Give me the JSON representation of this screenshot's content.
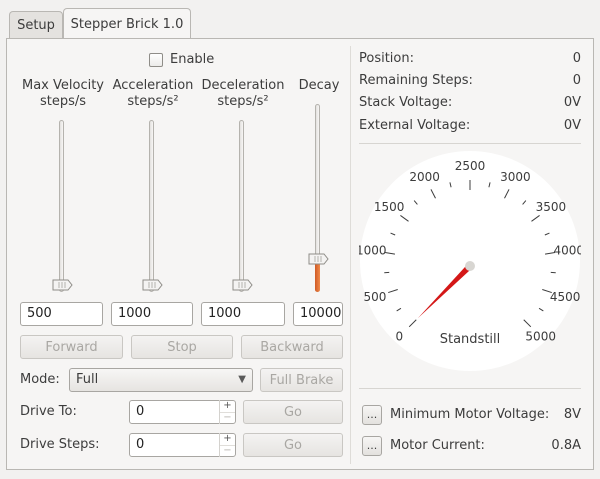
{
  "tabs": [
    {
      "label": "Setup",
      "active": false
    },
    {
      "label": "Stepper Brick 1.0",
      "active": true
    }
  ],
  "enable": {
    "label": "Enable",
    "checked": false
  },
  "sliders": [
    {
      "label": "Max Velocity\nsteps/s",
      "value": "500",
      "level": 0.0
    },
    {
      "label": "Acceleration\nsteps/s²",
      "value": "1000",
      "level": 0.0
    },
    {
      "label": "Deceleration\nsteps/s²",
      "value": "1000",
      "level": 0.0
    },
    {
      "label": "Decay",
      "value": "10000",
      "level": 0.15
    }
  ],
  "buttons": {
    "forward": "Forward",
    "stop": "Stop",
    "backward": "Backward",
    "full_brake": "Full Brake",
    "go1": "Go",
    "go2": "Go"
  },
  "mode": {
    "label": "Mode:",
    "selected": "Full"
  },
  "drive_to": {
    "label": "Drive To:",
    "value": "0"
  },
  "drive_steps": {
    "label": "Drive Steps:",
    "value": "0"
  },
  "status": [
    {
      "key": "Position:",
      "value": "0"
    },
    {
      "key": "Remaining Steps:",
      "value": "0"
    },
    {
      "key": "Stack Voltage:",
      "value": "0V"
    },
    {
      "key": "External Voltage:",
      "value": "0V"
    }
  ],
  "gauge": {
    "ticks": [
      "0",
      "500",
      "1000",
      "1500",
      "2000",
      "2500",
      "3000",
      "3500",
      "4000",
      "4500",
      "5000"
    ],
    "value": 0,
    "min": 0,
    "max": 5000,
    "caption": "Standstill",
    "needle_color": "#d41717"
  },
  "min_motor_voltage": {
    "button": "...",
    "label": "Minimum Motor Voltage:",
    "value": "8V"
  },
  "motor_current": {
    "button": "...",
    "label": "Motor Current:",
    "value": "0.8A"
  }
}
